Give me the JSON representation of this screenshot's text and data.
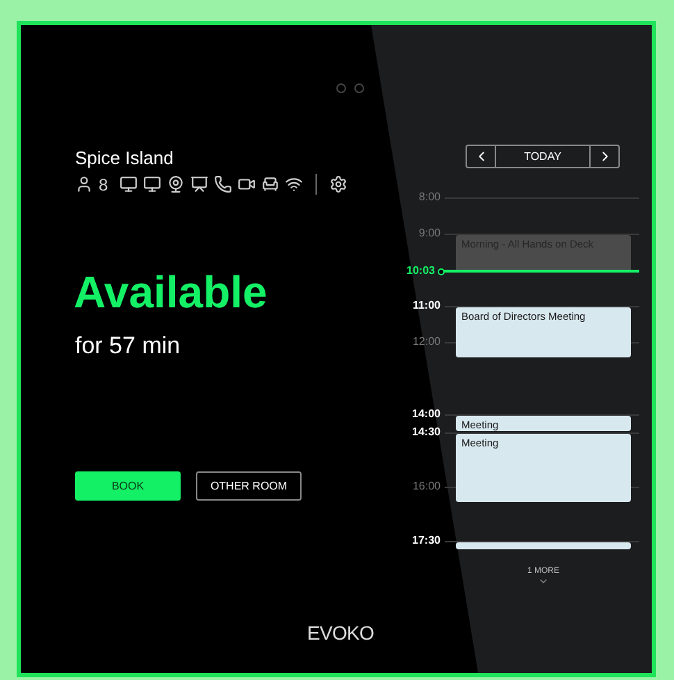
{
  "room": {
    "name": "Spice Island",
    "capacity": "8"
  },
  "status": {
    "title": "Available",
    "subtitle": "for 57 min"
  },
  "buttons": [
    {
      "label": "BOOK",
      "kind": "primary"
    },
    {
      "label": "OTHER ROOM",
      "kind": "outline"
    }
  ],
  "brand": "EVOKO",
  "calendar_nav": {
    "today": "TODAY"
  },
  "timeline": {
    "ticks": [
      {
        "label": "8:00",
        "bold": false
      },
      {
        "label": "9:00",
        "bold": false,
        "event": {
          "title": "Morning - All Hands on Deck",
          "kind": "past"
        }
      },
      {
        "label": "11:00",
        "bold": true,
        "event": {
          "title": "Board of Directors Meeting",
          "kind": "upcoming"
        }
      },
      {
        "label": "12:00",
        "bold": false
      },
      {
        "label": "14:00",
        "bold": true,
        "event": {
          "title": "Meeting",
          "kind": "upcoming"
        }
      },
      {
        "label": "14:30",
        "bold": true,
        "event": {
          "title": "Meeting",
          "kind": "upcoming"
        }
      },
      {
        "label": "16:00",
        "bold": false
      },
      {
        "label": "17:30",
        "bold": true,
        "event": {
          "kind": "upcoming"
        }
      }
    ],
    "now": "10:03",
    "more": "1 MORE"
  }
}
